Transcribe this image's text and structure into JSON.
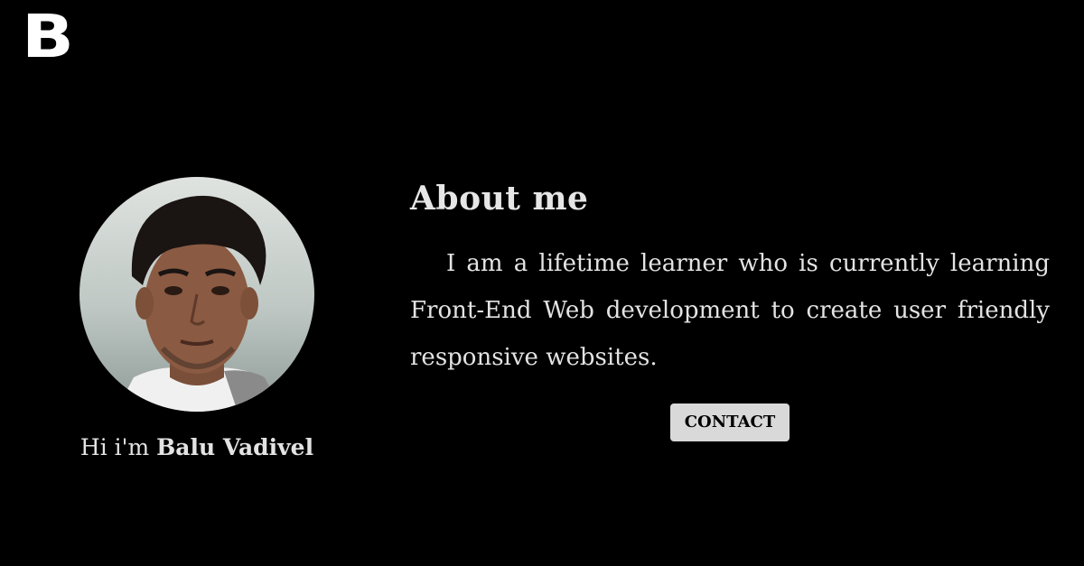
{
  "logo": {
    "letter": "B"
  },
  "profile": {
    "greeting_prefix": "Hi i'm ",
    "name": "Balu Vadivel"
  },
  "about": {
    "heading": "About me",
    "body": "I am a lifetime learner who is currently learning Front-End Web development to create user friendly responsive websites."
  },
  "contact": {
    "label": "CONTACT"
  },
  "colors": {
    "background": "#000000",
    "text": "#e3e3e3",
    "button_bg": "#d9d9d9",
    "button_text": "#000000"
  }
}
